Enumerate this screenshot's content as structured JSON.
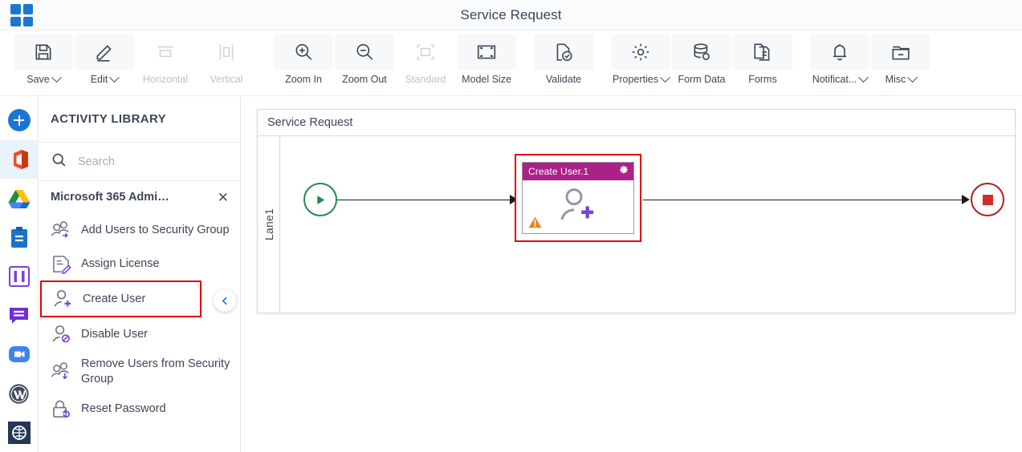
{
  "topbar": {
    "app_title": "Service Request",
    "waffle_icon": "apps-grid-icon",
    "waffle_color": "#1b76d3"
  },
  "ribbon": {
    "items": [
      {
        "label": "Save",
        "icon": "save-icon",
        "caret": true,
        "disabled": false
      },
      {
        "label": "Edit",
        "icon": "edit-pencil-icon",
        "caret": true,
        "disabled": false
      },
      {
        "label": "Horizontal",
        "icon": "horizontal-align-icon",
        "caret": false,
        "disabled": true
      },
      {
        "label": "Vertical",
        "icon": "vertical-align-icon",
        "caret": false,
        "disabled": true
      },
      {
        "label": "Zoom In",
        "icon": "zoom-in-icon",
        "caret": false,
        "disabled": false
      },
      {
        "label": "Zoom Out",
        "icon": "zoom-out-icon",
        "caret": false,
        "disabled": false
      },
      {
        "label": "Standard",
        "icon": "standard-size-icon",
        "caret": false,
        "disabled": true
      },
      {
        "label": "Model Size",
        "icon": "model-size-icon",
        "caret": false,
        "disabled": false
      },
      {
        "label": "Validate",
        "icon": "validate-icon",
        "caret": false,
        "disabled": false
      },
      {
        "label": "Properties",
        "icon": "gear-icon",
        "caret": true,
        "disabled": false
      },
      {
        "label": "Form Data",
        "icon": "database-icon",
        "caret": false,
        "disabled": false
      },
      {
        "label": "Forms",
        "icon": "document-icon",
        "caret": false,
        "disabled": false
      },
      {
        "label": "Notificat...",
        "icon": "bell-icon",
        "caret": true,
        "disabled": false
      },
      {
        "label": "Misc",
        "icon": "folder-icon",
        "caret": true,
        "disabled": false
      }
    ]
  },
  "rail": {
    "add_button_icon": "plus-circle-icon",
    "items": [
      {
        "name": "office365-icon",
        "selected": true
      },
      {
        "name": "google-drive-icon",
        "selected": false
      },
      {
        "name": "clipboard-icon",
        "selected": false
      },
      {
        "name": "jira-icon",
        "selected": false
      },
      {
        "name": "chat-icon",
        "selected": false
      },
      {
        "name": "zoom-app-icon",
        "selected": false
      },
      {
        "name": "wordpress-icon",
        "selected": false
      },
      {
        "name": "globe-grid-icon",
        "selected": false
      }
    ]
  },
  "library": {
    "title": "ACTIVITY LIBRARY",
    "search_placeholder": "Search",
    "search_value": "",
    "search_icon": "search-icon",
    "category": "Microsoft 365 Admi…",
    "category_close_icon": "close-icon",
    "highlight_color": "#e00000",
    "activities": [
      {
        "label": "Add Users to Security Group",
        "icon": "add-users-to-group-icon",
        "highlighted": false
      },
      {
        "label": "Assign License",
        "icon": "assign-license-icon",
        "highlighted": false
      },
      {
        "label": "Create User",
        "icon": "create-user-icon",
        "highlighted": true
      },
      {
        "label": "Disable User",
        "icon": "disable-user-icon",
        "highlighted": false
      },
      {
        "label": "Remove Users from Security Group",
        "icon": "remove-users-from-group-icon",
        "highlighted": false
      },
      {
        "label": "Reset Password",
        "icon": "reset-password-icon",
        "highlighted": false
      }
    ],
    "collapse_icon": "chevron-left-icon"
  },
  "canvas": {
    "pool_title": "Service Request",
    "lane_label": "Lane1",
    "start_node": {
      "name": "start-event",
      "icon": "play-triangle-icon",
      "color": "#1f8a4c"
    },
    "end_node": {
      "name": "end-event",
      "icon": "stop-square-icon",
      "color": "#ad2122"
    },
    "task": {
      "name": "Create User.1",
      "header_color": "#ac2089",
      "gear_icon": "gear-icon",
      "warning_icon": "warning-triangle-icon",
      "glyph_icon": "create-user-icon",
      "selected": true,
      "selection_color": "#e00000"
    }
  }
}
